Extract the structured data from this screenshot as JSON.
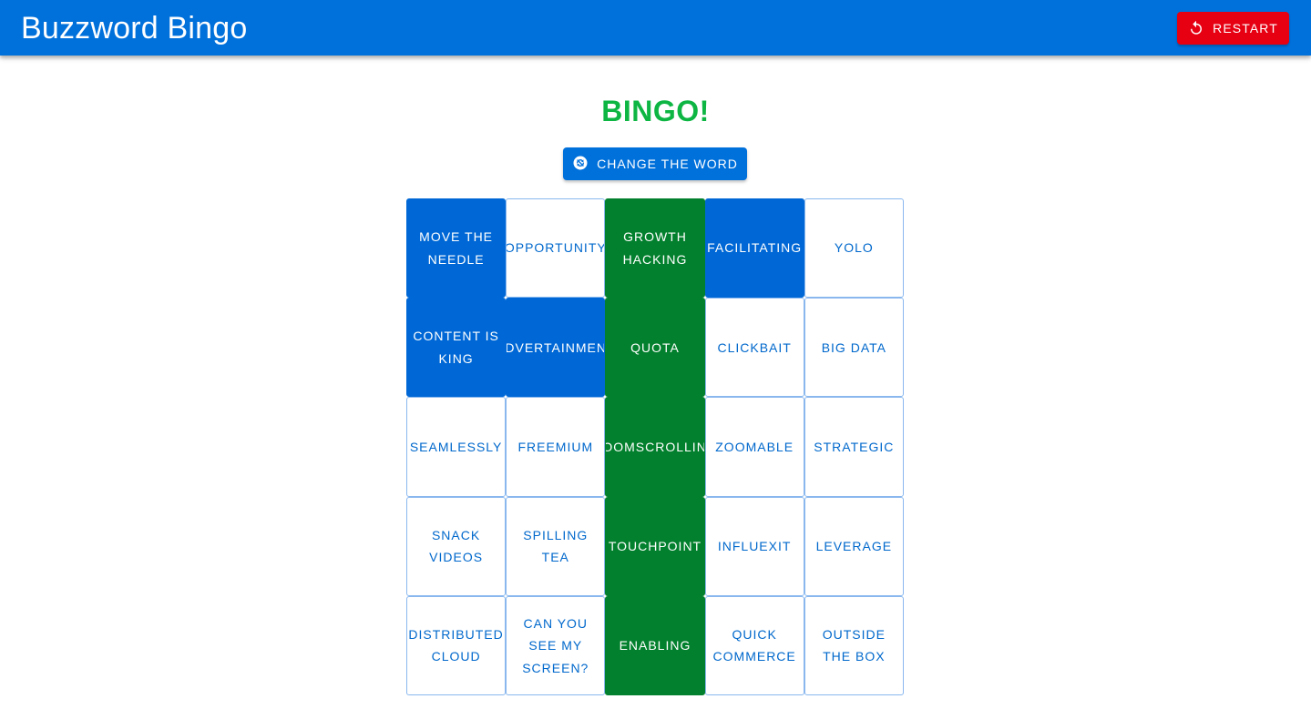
{
  "app": {
    "title": "Buzzword Bingo",
    "restart_label": "Restart"
  },
  "main": {
    "status": "BINGO!",
    "change_word_label": "Change the word"
  },
  "colors": {
    "appbar": "#0070db",
    "restart": "#e60012",
    "bingo_text": "#0db543",
    "marked_cell": "#0068d6",
    "winning_cell": "#03802d",
    "cell_text": "#0068cc"
  },
  "board": {
    "cells": [
      {
        "label": "Move the needle",
        "state": "marked"
      },
      {
        "label": "Opportunity",
        "state": "unmarked"
      },
      {
        "label": "Growth hacking",
        "state": "winning"
      },
      {
        "label": "Facilitating",
        "state": "marked"
      },
      {
        "label": "YOLO",
        "state": "unmarked"
      },
      {
        "label": "Content is king",
        "state": "marked"
      },
      {
        "label": "Advertainment",
        "state": "marked"
      },
      {
        "label": "Quota",
        "state": "winning"
      },
      {
        "label": "Clickbait",
        "state": "unmarked"
      },
      {
        "label": "Big data",
        "state": "unmarked"
      },
      {
        "label": "Seamlessly",
        "state": "unmarked"
      },
      {
        "label": "Freemium",
        "state": "unmarked"
      },
      {
        "label": "Doomscrolling",
        "state": "winning"
      },
      {
        "label": "Zoomable",
        "state": "unmarked"
      },
      {
        "label": "Strategic",
        "state": "unmarked"
      },
      {
        "label": "Snack videos",
        "state": "unmarked"
      },
      {
        "label": "Spilling tea",
        "state": "unmarked"
      },
      {
        "label": "Touchpoint",
        "state": "winning"
      },
      {
        "label": "Influexit",
        "state": "unmarked"
      },
      {
        "label": "Leverage",
        "state": "unmarked"
      },
      {
        "label": "Distributed cloud",
        "state": "unmarked"
      },
      {
        "label": "Can you see my screen?",
        "state": "unmarked"
      },
      {
        "label": "Enabling",
        "state": "winning"
      },
      {
        "label": "Quick commerce",
        "state": "unmarked"
      },
      {
        "label": "Outside the box",
        "state": "unmarked"
      }
    ]
  }
}
